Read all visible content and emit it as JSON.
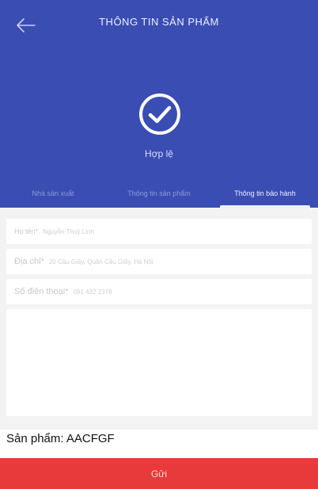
{
  "header": {
    "title": "THÔNG TIN SẢN PHẨM",
    "back_icon": "arrow-left-icon",
    "status_icon": "check-circle-icon",
    "status_text": "Hợp lệ",
    "colors": {
      "background": "#3a4db3",
      "accent": "#ffffff"
    }
  },
  "tabs": [
    {
      "label": "Nhà sản xuất",
      "active": false
    },
    {
      "label": "Thông tin sản phẩm",
      "active": false
    },
    {
      "label": "Thông tin bảo hành",
      "active": true
    }
  ],
  "form": {
    "fields": [
      {
        "label": "Họ tên*",
        "value": "Nguyễn Thuỳ Linh"
      },
      {
        "label": "Địa chỉ*",
        "value": "20 Cầu Giấy, Quận Cầu Giấy, Hà Nội"
      },
      {
        "label": "Số điện thoại*",
        "value": "091 432 2378"
      }
    ]
  },
  "product": {
    "text": "Sản phẩm: AACFGF"
  },
  "submit": {
    "label": "Gửi",
    "color": "#e83a3a"
  }
}
